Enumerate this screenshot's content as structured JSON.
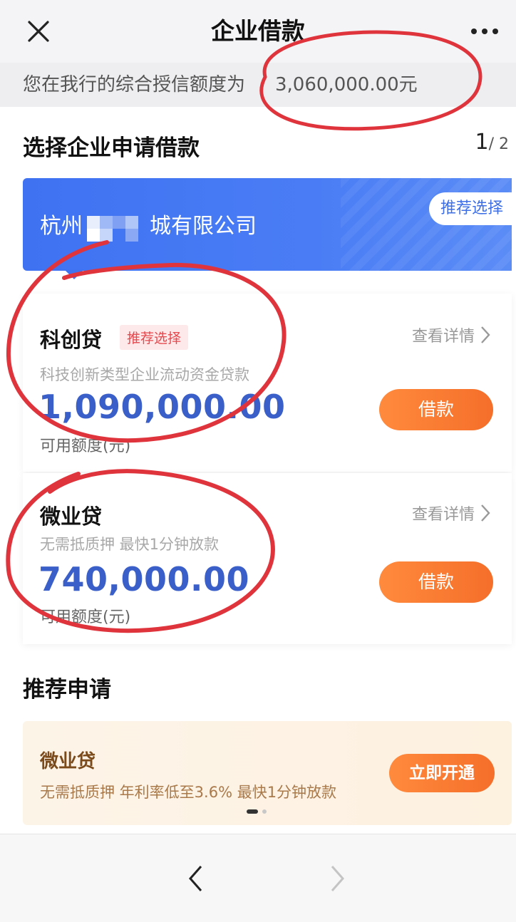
{
  "header": {
    "title": "企业借款",
    "close_icon": "close-icon",
    "more_icon": "more-icon"
  },
  "credit_line": {
    "label": "您在我行的综合授信额度为",
    "amount": "3,060,000.00元"
  },
  "select_section": {
    "title": "选择企业申请借款",
    "page_current": "1",
    "page_total": "/ 2",
    "company": {
      "name_prefix": "杭州",
      "name_suffix": "城有限公司",
      "recommend_label": "推荐选择"
    }
  },
  "loans": [
    {
      "name": "科创贷",
      "tag": "推荐选择",
      "description": "科技创新类型企业流动资金贷款",
      "amount": "1,090,000.00",
      "unit_label": "可用额度(元)",
      "detail_label": "查看详情",
      "borrow_label": "借款"
    },
    {
      "name": "微业贷",
      "description": "无需抵质押 最快1分钟放款",
      "amount": "740,000.00",
      "unit_label": "可用额度(元)",
      "detail_label": "查看详情",
      "borrow_label": "借款"
    }
  ],
  "recommend": {
    "title": "推荐申请",
    "promo": {
      "name": "微业贷",
      "description": "无需抵质押 年利率低至3.6% 最快1分钟放款",
      "button_label": "立即开通"
    }
  },
  "bottom_nav": {
    "back_icon": "chevron-left-icon",
    "forward_icon": "chevron-right-icon"
  },
  "colors": {
    "brand_blue": "#3e72f1",
    "amount_blue": "#3b5fc8",
    "accent_orange": "#f56f2a",
    "annotation_red": "#e0343d"
  }
}
